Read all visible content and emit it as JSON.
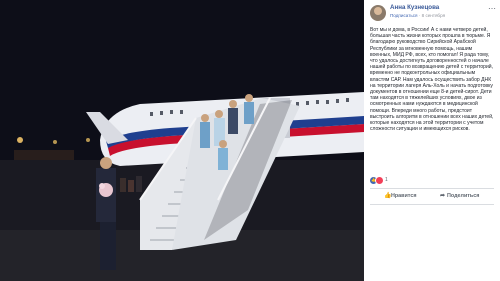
{
  "post": {
    "author": "Анна Кузнецова",
    "subscribe_label": "Подписаться",
    "date": "8 сентября",
    "text": "Вот мы и дома, в России! А с нами четверо детей, большая часть жизни которых прошла в тюрьме. Я благодарю руководство Сирийской Арабской Республики за мгновенную помощь, нашим военных, МИД РФ, всех, кто помогал! Я рада тому, что удалось достигнуть договоренностей о начале нашей работы по возвращению детей с территорий, временно не подконтрольных официальным властям САР. Нам удалось осуществить забор ДНК на территории лагеря Аль-Холь и начать подготовку документов в отношении еще 8-и детей-сирот. Дети там находятся в тяжелейших условиях, двое из осмотренных нами нуждаются в медицинской помощи. Впереди много работы, предстоит выстроить алгоритм в отношении всех наших детей, которые находятся на этой территории с учетом сложности ситуации и имеющихся рисков.",
    "reactions_count": "1",
    "like_label": "Нравится",
    "share_label": "Поделиться"
  },
  "icons": {
    "like": "thumbs-up-icon",
    "share": "share-arrow-icon",
    "more": "more-options-icon"
  },
  "colors": {
    "brand": "#385898",
    "like_reaction": "#4267b2",
    "love_reaction": "#f33e58",
    "plane_stripe_red": "#c8102e",
    "plane_stripe_blue": "#1f3f8f"
  }
}
